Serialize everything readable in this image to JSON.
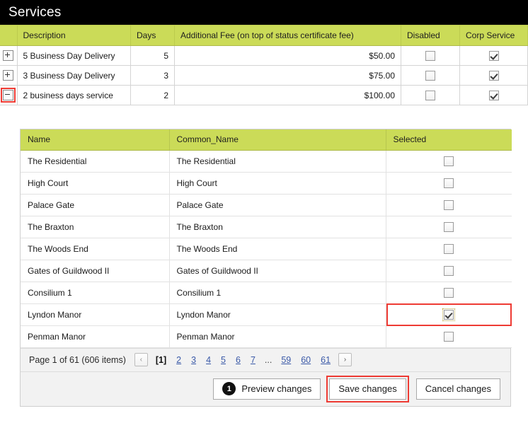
{
  "header": {
    "title": "Services"
  },
  "services_grid": {
    "columns": [
      "",
      "Description",
      "Days",
      "Additional Fee (on top of status certificate fee)",
      "Disabled",
      "Corp Service"
    ],
    "rows": [
      {
        "expander": "plus-icon",
        "expander_annotated": false,
        "description": "5 Business Day Delivery",
        "days": "5",
        "fee": "$50.00",
        "disabled_checked": false,
        "corp_service_checked": true
      },
      {
        "expander": "plus-icon",
        "expander_annotated": false,
        "description": "3 Business Day Delivery",
        "days": "3",
        "fee": "$75.00",
        "disabled_checked": false,
        "corp_service_checked": true
      },
      {
        "expander": "minus-icon",
        "expander_annotated": true,
        "description": "2 business days service",
        "days": "2",
        "fee": "$100.00",
        "disabled_checked": false,
        "corp_service_checked": true
      }
    ]
  },
  "detail_grid": {
    "columns": [
      "Name",
      "Common_Name",
      "Selected"
    ],
    "rows": [
      {
        "name": "The Residential",
        "common_name": "The Residential",
        "selected": false,
        "highlighted": false
      },
      {
        "name": "High Court",
        "common_name": "High Court",
        "selected": false,
        "highlighted": false
      },
      {
        "name": "Palace Gate",
        "common_name": "Palace Gate",
        "selected": false,
        "highlighted": false
      },
      {
        "name": "The Braxton",
        "common_name": "The Braxton",
        "selected": false,
        "highlighted": false
      },
      {
        "name": "The Woods End",
        "common_name": "The Woods End",
        "selected": false,
        "highlighted": false
      },
      {
        "name": "Gates of Guildwood II",
        "common_name": "Gates of Guildwood II",
        "selected": false,
        "highlighted": false
      },
      {
        "name": "Consilium 1",
        "common_name": "Consilium 1",
        "selected": false,
        "highlighted": false
      },
      {
        "name": "Lyndon Manor",
        "common_name": "Lyndon Manor",
        "selected": true,
        "highlighted": true
      },
      {
        "name": "Penman Manor",
        "common_name": "Penman Manor",
        "selected": false,
        "highlighted": false
      }
    ]
  },
  "pager": {
    "status": "Page 1 of 61 (606 items)",
    "prev_label": "‹",
    "next_label": "›",
    "prev_enabled": false,
    "next_enabled": true,
    "current_page": "[1]",
    "links": [
      "2",
      "3",
      "4",
      "5",
      "6",
      "7"
    ],
    "ellipsis": "...",
    "tail_links": [
      "59",
      "60",
      "61"
    ]
  },
  "commands": {
    "preview_badge": "1",
    "preview_label": "Preview changes",
    "save_label": "Save changes",
    "cancel_label": "Cancel changes"
  },
  "colors": {
    "header_green": "#cbdb58",
    "title_bar": "#000000",
    "annotation_red": "#ee3b34",
    "highlight_green": "#dcefc4",
    "link_blue": "#3b5aa8"
  }
}
